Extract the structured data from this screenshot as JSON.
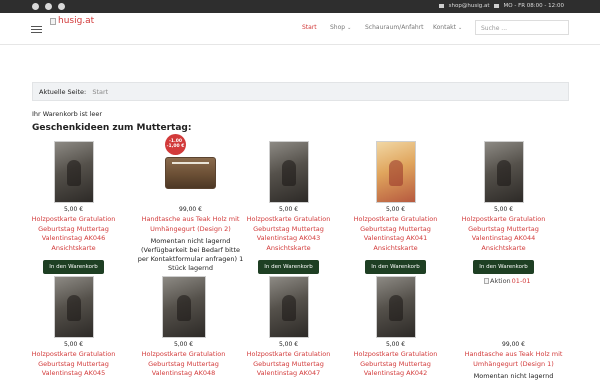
{
  "topbar": {
    "email": "shop@husig.at",
    "hours": "MO - FR 08:00 - 12:00"
  },
  "header": {
    "logo_text": "husig.at",
    "nav": [
      {
        "label": "Start",
        "active": true,
        "dropdown": false
      },
      {
        "label": "Shop",
        "active": false,
        "dropdown": true
      },
      {
        "label": "Schauraum/Anfahrt",
        "active": false,
        "dropdown": false
      },
      {
        "label": "Kontakt",
        "active": false,
        "dropdown": true
      }
    ],
    "search_placeholder": "Suche ..."
  },
  "breadcrumb": {
    "label": "Aktuelle Seite:",
    "current": "Start"
  },
  "cart_status": "Ihr Warenkorb ist leer",
  "section_title": "Geschenkideen zum Muttertag:",
  "products_row1": [
    {
      "price": "5,00 €",
      "name": "Holzpostkarte Gratulation Geburtstag Muttertag Valentinstag AK046 Ansichtskarte",
      "button": "In den Warenkorb"
    },
    {
      "price": "99,00 €",
      "name": "Handtasche aus Teak Holz mit Umhängegurt (Design 2)",
      "note": "Momentan nicht lagernd (Verfügbarkeit bei Bedarf bitte per Kontaktformular anfragen) 1 Stück lagernd",
      "sale_badge": "-1.00 -1,00 €"
    },
    {
      "price": "5,00 €",
      "name": "Holzpostkarte Gratulation Geburtstag Muttertag Valentinstag AK043 Ansichtskarte",
      "button": "In den Warenkorb"
    },
    {
      "price": "5,00 €",
      "name": "Holzpostkarte Gratulation Geburtstag Muttertag Valentinstag AK041 Ansichtskarte",
      "button": "In den Warenkorb"
    },
    {
      "price": "5,00 €",
      "name": "Holzpostkarte Gratulation Geburtstag Muttertag Valentinstag AK044 Ansichtskarte",
      "button": "In den Warenkorb"
    }
  ],
  "products_row2": [
    {
      "price": "5,00 €",
      "name": "Holzpostkarte Gratulation Geburtstag Muttertag Valentinstag AK045"
    },
    {
      "price": "5,00 €",
      "name": "Holzpostkarte Gratulation Geburtstag Muttertag Valentinstag AK048"
    },
    {
      "price": "5,00 €",
      "name": "Holzpostkarte Gratulation Geburtstag Muttertag Valentinstag AK047"
    },
    {
      "price": "5,00 €",
      "name": "Holzpostkarte Gratulation Geburtstag Muttertag Valentinstag AK042"
    },
    {
      "price": "99,00 €",
      "name": "Handtasche aus Teak Holz mit Umhängegurt (Design 1)",
      "note": "Momentan nicht lagernd",
      "image_alt": "Aktion",
      "image_alt_suffix": "01-01"
    }
  ],
  "colors": {
    "accent": "#d23a3a",
    "button_bg": "#1e3f23",
    "topbar_bg": "#2e2e2e"
  }
}
